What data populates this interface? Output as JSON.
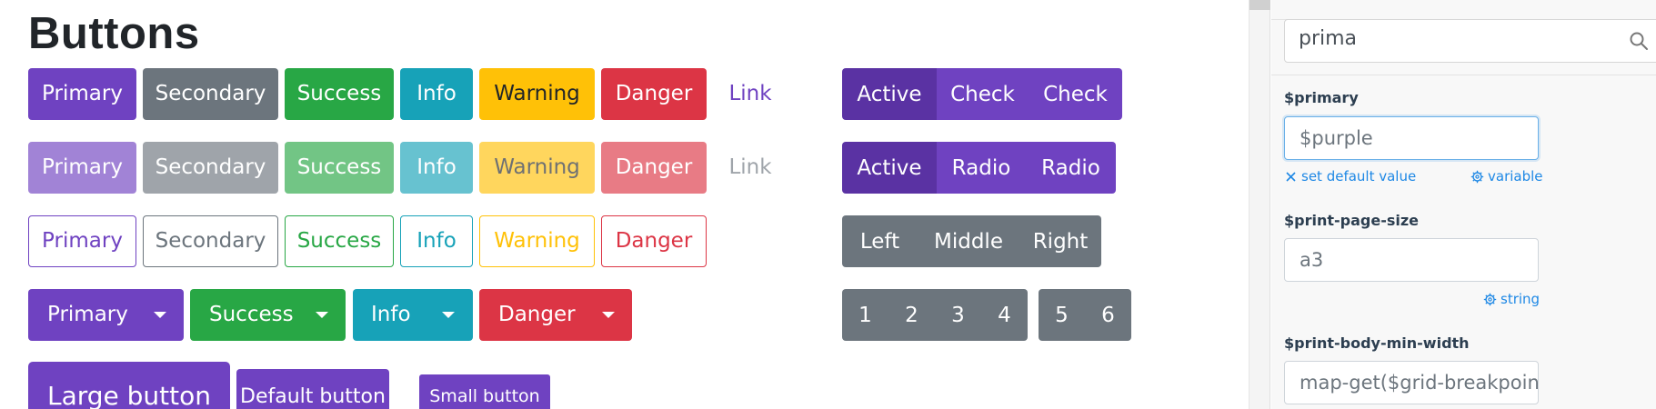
{
  "page_title": "Buttons",
  "colors": {
    "primary": "#6f42c1",
    "secondary": "#6c757d",
    "success": "#28a745",
    "info": "#17a2b8",
    "warning": "#ffc107",
    "danger": "#dc3545",
    "link_accent": "#1e88e5"
  },
  "solid_row": [
    "Primary",
    "Secondary",
    "Success",
    "Info",
    "Warning",
    "Danger",
    "Link"
  ],
  "disabled_row": [
    "Primary",
    "Secondary",
    "Success",
    "Info",
    "Warning",
    "Danger",
    "Link"
  ],
  "outline_row": [
    "Primary",
    "Secondary",
    "Success",
    "Info",
    "Warning",
    "Danger"
  ],
  "split_row": [
    "Primary",
    "Success",
    "Info",
    "Danger"
  ],
  "size_row": [
    "Large button",
    "Default button",
    "Small button"
  ],
  "check_group": [
    "Active",
    "Check",
    "Check"
  ],
  "radio_group": [
    "Active",
    "Radio",
    "Radio"
  ],
  "position_group": [
    "Left",
    "Middle",
    "Right"
  ],
  "pager_group_a": [
    "1",
    "2",
    "3",
    "4"
  ],
  "pager_group_b": [
    "5",
    "6"
  ],
  "panel": {
    "search_value": "prima",
    "search_icon": "search-icon",
    "vars": [
      {
        "name": "$primary",
        "value": "$purple",
        "reset_link": "set default value",
        "type_label": "variable"
      },
      {
        "name": "$print-page-size",
        "value": "a3",
        "type_label": "string"
      },
      {
        "name": "$print-body-min-width",
        "value": "map-get($grid-breakpoin"
      }
    ]
  }
}
